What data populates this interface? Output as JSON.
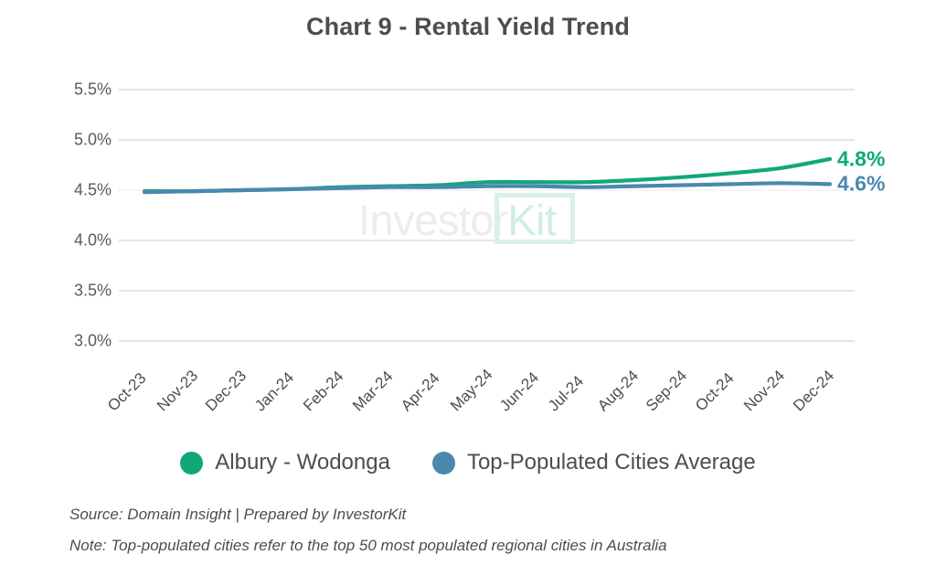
{
  "chart_data": {
    "type": "line",
    "title": "Chart 9 - Rental Yield Trend",
    "xlabel": "",
    "ylabel": "",
    "ylim": [
      3.0,
      5.5
    ],
    "ytick_values": [
      5.5,
      5.0,
      4.5,
      4.0,
      3.5,
      3.0
    ],
    "ytick_labels": [
      "5.5%",
      "5.0%",
      "4.5%",
      "4.0%",
      "3.5%",
      "3.0%"
    ],
    "grid": true,
    "legend_position": "bottom-center",
    "categories": [
      "Oct-23",
      "Nov-23",
      "Dec-23",
      "Jan-24",
      "Feb-24",
      "Mar-24",
      "Apr-24",
      "May-24",
      "Jun-24",
      "Jul-24",
      "Aug-24",
      "Sep-24",
      "Oct-24",
      "Nov-24",
      "Dec-24"
    ],
    "series": [
      {
        "name": "Albury - Wodonga",
        "color": "#10a87b",
        "values": [
          4.49,
          4.49,
          4.5,
          4.51,
          4.53,
          4.54,
          4.55,
          4.58,
          4.58,
          4.58,
          4.6,
          4.63,
          4.67,
          4.72,
          4.81
        ],
        "end_label": "4.8%"
      },
      {
        "name": "Top-Populated Cities Average",
        "color": "#4a88ae",
        "values": [
          4.48,
          4.49,
          4.5,
          4.51,
          4.52,
          4.53,
          4.53,
          4.54,
          4.54,
          4.53,
          4.54,
          4.55,
          4.56,
          4.57,
          4.56
        ],
        "end_label": "4.6%"
      }
    ]
  },
  "watermark": {
    "part1": "Investor",
    "part2": "Kit"
  },
  "legend": {
    "items": [
      {
        "label": "Albury - Wodonga",
        "color": "#10a87b"
      },
      {
        "label": "Top-Populated Cities Average",
        "color": "#4a88ae"
      }
    ]
  },
  "footer": {
    "source": "Source: Domain Insight | Prepared by InvestorKit",
    "note": "Note: Top-populated cities refer to the top 50 most populated regional cities in Australia"
  }
}
